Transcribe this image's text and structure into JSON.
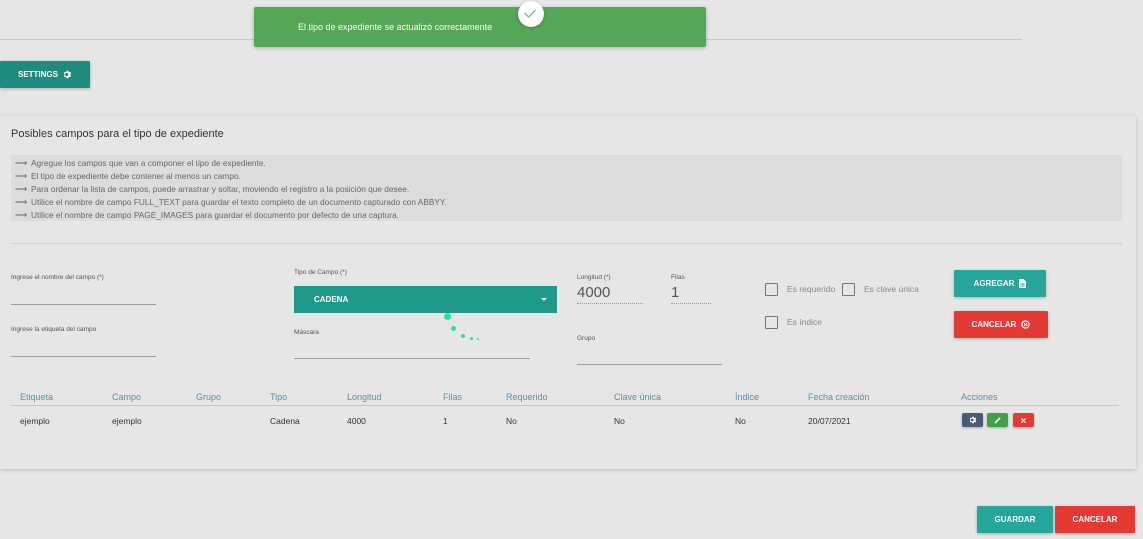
{
  "toast": {
    "message": "El tipo de expediente se actualizó correctamente"
  },
  "settings_label": "SETTINGS",
  "card": {
    "title": "Posibles campos para el tipo de expediente",
    "notes": [
      "Agregue los campos que van a componer el tipo de expediente.",
      "El tipo de expediente debe contener al menos un campo.",
      "Para ordenar la lista de campos, puede arrastrar y soltar, moviendo el registro a la posición que desee.",
      "Utilice el nombre de campo FULL_TEXT para guardar el texto completo de un documento capturado con ABBYY.",
      "Utilice el nombre de campo PAGE_IMAGES para guardar el documento por defecto de una captura."
    ]
  },
  "form": {
    "field_name_label": "Ingrese el nombre del campo (*)",
    "field_tag_label": "Ingrese la etiqueta del campo",
    "field_type_label": "Tipo de Campo (*)",
    "field_type_value": "CADENA",
    "mask_label": "Máscara",
    "length_label": "Longitud (*)",
    "length_value": "4000",
    "rows_label": "Filas",
    "rows_value": "1",
    "group_label": "Grupo",
    "required_label": "Es requerido",
    "unique_label": "Es clave única",
    "index_label": "Es índice",
    "add_label": "AGREGAR",
    "cancel_label": "CANCELAR"
  },
  "table": {
    "headers": [
      "Etiqueta",
      "Campo",
      "Grupo",
      "Tipo",
      "Longitud",
      "Filas",
      "Requerido",
      "Clave única",
      "Índice",
      "Fecha creación",
      "Acciones"
    ],
    "rows": [
      {
        "etiqueta": "ejemplo",
        "campo": "ejemplo",
        "grupo": "",
        "tipo": "Cadena",
        "longitud": "4000",
        "filas": "1",
        "requerido": "No",
        "clave": "No",
        "indice": "No",
        "fecha": "20/07/2021"
      }
    ]
  },
  "footer": {
    "save_label": "GUARDAR",
    "cancel_label": "CANCELAR"
  },
  "colors": {
    "teal": "#26a69a",
    "red": "#e53935",
    "toast_green": "#56a657",
    "settings_blue": "#4a5b73",
    "edit_green": "#43a047"
  },
  "icons": [
    "check-icon",
    "gear-icon",
    "arrow-right-icon",
    "caret-down-icon",
    "document-icon",
    "close-circle-icon",
    "pencil-icon",
    "close-icon"
  ]
}
